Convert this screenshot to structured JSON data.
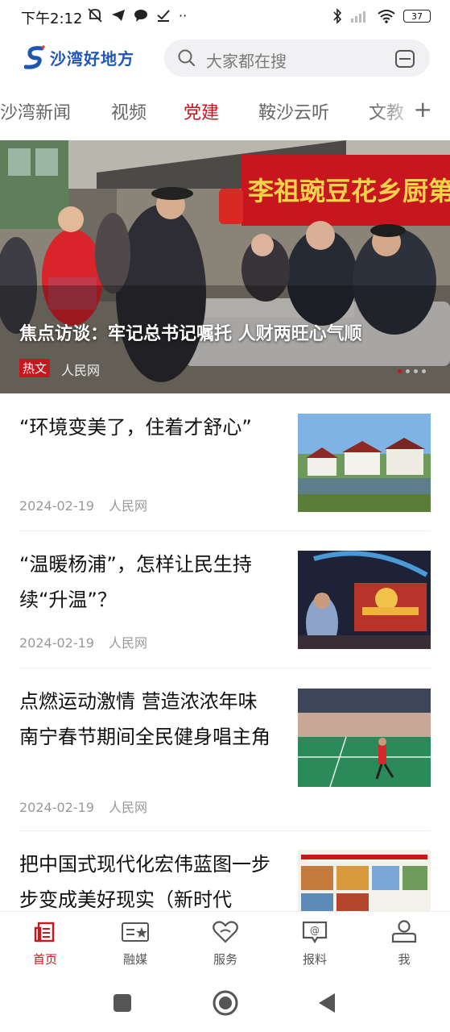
{
  "status": {
    "time": "下午2:12",
    "battery": "37",
    "icons_left": [
      "mute-icon",
      "telegram-icon",
      "chat-icon",
      "check-icon",
      "more-icon"
    ],
    "icons_right": [
      "bluetooth-icon",
      "signal-icon",
      "wifi-icon",
      "battery-icon"
    ]
  },
  "header": {
    "logo_text": "沙湾好地方",
    "search_placeholder": "大家都在搜"
  },
  "tabs": [
    {
      "label": "沙湾新闻"
    },
    {
      "label": "视频"
    },
    {
      "label": "党建",
      "active": true
    },
    {
      "label": "鞍沙云听"
    },
    {
      "label": "文教"
    }
  ],
  "tab_add": "+",
  "hero": {
    "title": "焦点访谈：牢记总书记嘱托 人财两旺心气顺",
    "tag": "热文",
    "source": "人民网",
    "banner_text": "李祖豌豆花乡厨第"
  },
  "news": [
    {
      "title": "“环境变美了，住着才舒心”",
      "date": "2024-02-19",
      "source": "人民网"
    },
    {
      "title": "“温暖杨浦”，怎样让民生持续“升温”？",
      "date": "2024-02-19",
      "source": "人民网"
    },
    {
      "title": "点燃运动激情 营造浓浓年味 南宁春节期间全民健身唱主角",
      "date": "2024-02-19",
      "source": "人民网"
    },
    {
      "title": "把中国式现代化宏伟蓝图一步步变成美好现实（新时代",
      "date": "",
      "source": ""
    }
  ],
  "nav": [
    {
      "label": "首页",
      "icon": "home-icon",
      "active": true
    },
    {
      "label": "融媒",
      "icon": "media-icon"
    },
    {
      "label": "服务",
      "icon": "service-icon"
    },
    {
      "label": "报料",
      "icon": "report-icon"
    },
    {
      "label": "我",
      "icon": "profile-icon"
    }
  ],
  "colors": {
    "accent": "#c8161e",
    "brand": "#1f55b5"
  }
}
